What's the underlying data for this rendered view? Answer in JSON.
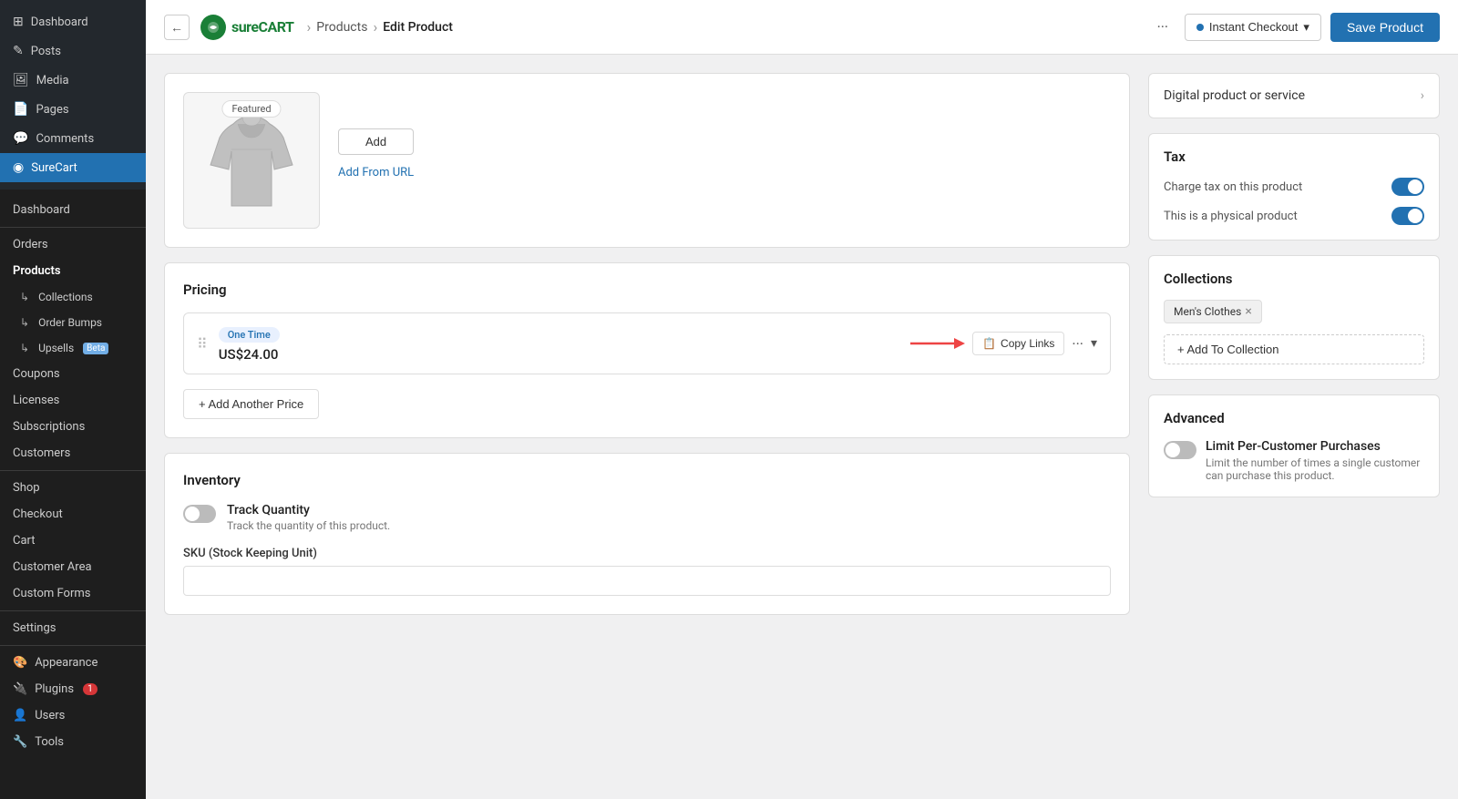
{
  "sidebar": {
    "top_items": [
      {
        "label": "Dashboard",
        "icon": "⊞"
      },
      {
        "label": "Posts",
        "icon": "✎"
      },
      {
        "label": "Media",
        "icon": "🖼"
      },
      {
        "label": "Pages",
        "icon": "📄"
      },
      {
        "label": "Comments",
        "icon": "💬"
      },
      {
        "label": "SureCart",
        "icon": "◉",
        "active": true
      }
    ],
    "surecart_items": [
      {
        "label": "Dashboard",
        "type": "item"
      },
      {
        "label": "Orders",
        "type": "group"
      },
      {
        "label": "Products",
        "type": "item",
        "active": true,
        "bold": true
      },
      {
        "label": "Collections",
        "type": "sub"
      },
      {
        "label": "Order Bumps",
        "type": "sub"
      },
      {
        "label": "Upsells",
        "type": "sub",
        "beta": true
      },
      {
        "label": "Coupons",
        "type": "item"
      },
      {
        "label": "Licenses",
        "type": "item"
      },
      {
        "label": "Subscriptions",
        "type": "item"
      },
      {
        "label": "Customers",
        "type": "item"
      }
    ],
    "store_items": [
      {
        "label": "Shop"
      },
      {
        "label": "Checkout"
      },
      {
        "label": "Cart"
      },
      {
        "label": "Customer Area"
      },
      {
        "label": "Custom Forms"
      }
    ],
    "settings_items": [
      {
        "label": "Settings"
      }
    ],
    "bottom_items": [
      {
        "label": "Appearance",
        "icon": "🎨"
      },
      {
        "label": "Plugins",
        "icon": "🔌",
        "badge": "1"
      },
      {
        "label": "Users",
        "icon": "👤"
      },
      {
        "label": "Tools",
        "icon": "🔧"
      }
    ]
  },
  "topbar": {
    "breadcrumbs": [
      "Products",
      "Edit Product"
    ],
    "logo_text": "sure",
    "logo_cart": "CART",
    "more_label": "···",
    "instant_checkout_label": "Instant Checkout",
    "save_label": "Save Product"
  },
  "main": {
    "image_section": {
      "featured_badge": "Featured",
      "add_button": "Add",
      "add_url_button": "Add From URL"
    },
    "pricing": {
      "title": "Pricing",
      "price_row": {
        "type_label": "One Time",
        "amount": "US$24.00",
        "copy_links": "Copy Links"
      },
      "add_price_label": "+ Add Another Price"
    },
    "inventory": {
      "title": "Inventory",
      "track_quantity_label": "Track Quantity",
      "track_quantity_desc": "Track the quantity of this product.",
      "sku_label": "SKU (Stock Keeping Unit)"
    }
  },
  "right": {
    "digital_service_label": "Digital product or service",
    "tax": {
      "title": "Tax",
      "charge_tax_label": "Charge tax on this product",
      "physical_product_label": "This is a physical product"
    },
    "collections": {
      "title": "Collections",
      "existing_tag": "Men's Clothes",
      "add_label": "+ Add To Collection"
    },
    "advanced": {
      "title": "Advanced",
      "limit_label": "Limit Per-Customer Purchases",
      "limit_desc": "Limit the number of times a single customer can purchase this product."
    }
  }
}
